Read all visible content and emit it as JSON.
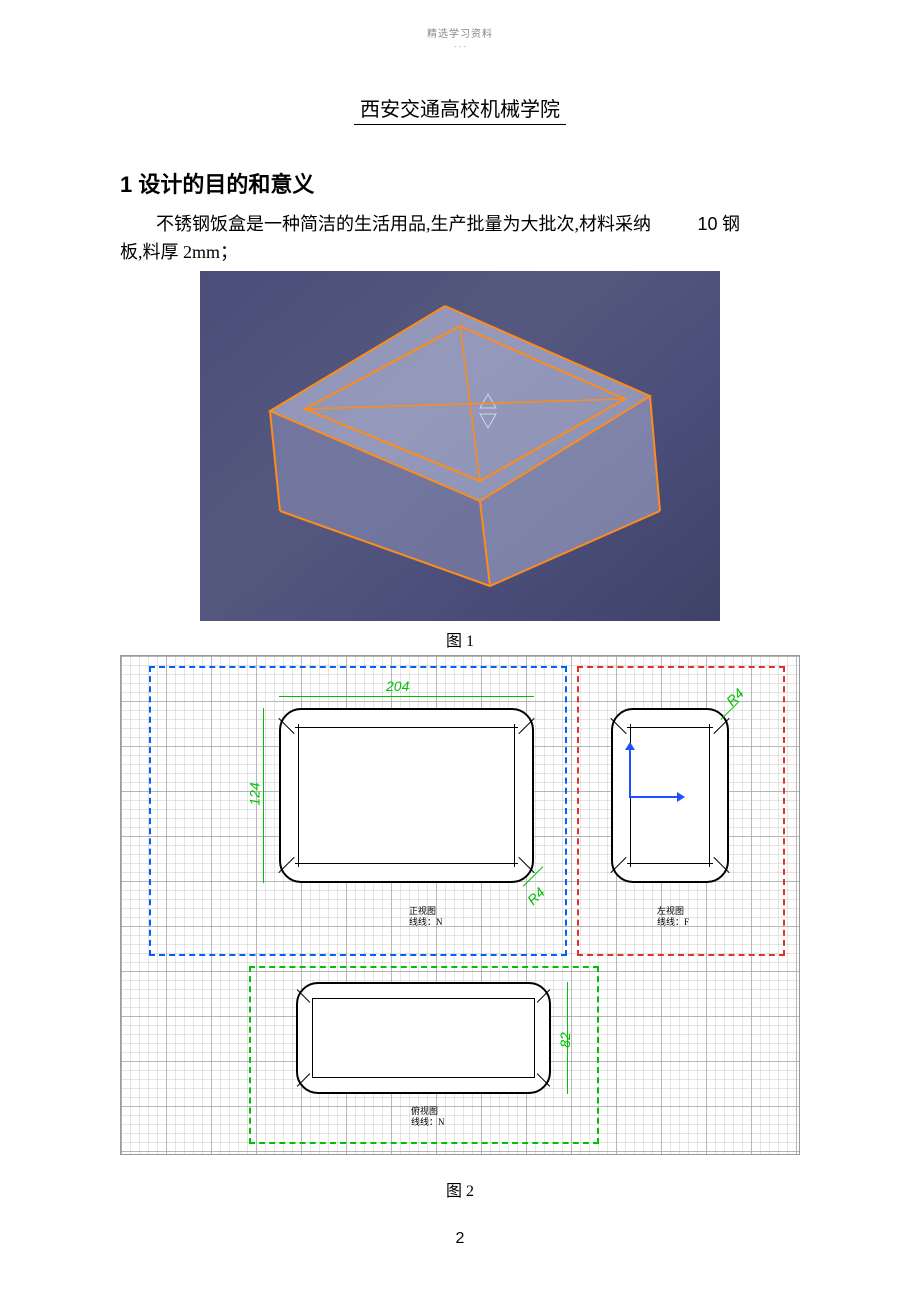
{
  "header": {
    "small_text": "精选学习资料",
    "dashes": "- - -"
  },
  "title": "西安交通高校机械学院",
  "section1": {
    "heading": "1 设计的目的和意义",
    "para_part1": "不锈钢饭盒是一种简洁的生活用品,生产批量为大批次,材料采纳",
    "steel_grade": "10",
    "steel_suffix": "钢",
    "para_part2": "板,料厚 2mm；"
  },
  "figures": {
    "fig1_caption": "图 1",
    "fig2_caption": "图 2"
  },
  "drawing": {
    "front_view": {
      "label_line1": "正视图",
      "label_line2": "线线：N",
      "width": "204",
      "height": "124",
      "radius": "R4"
    },
    "left_view": {
      "label_line1": "左视图",
      "label_line2": "线线：F",
      "radius_top": "R4"
    },
    "top_view": {
      "label_line1": "俯视图",
      "label_line2": "线线：N",
      "height": "82"
    }
  },
  "page_number": "2"
}
